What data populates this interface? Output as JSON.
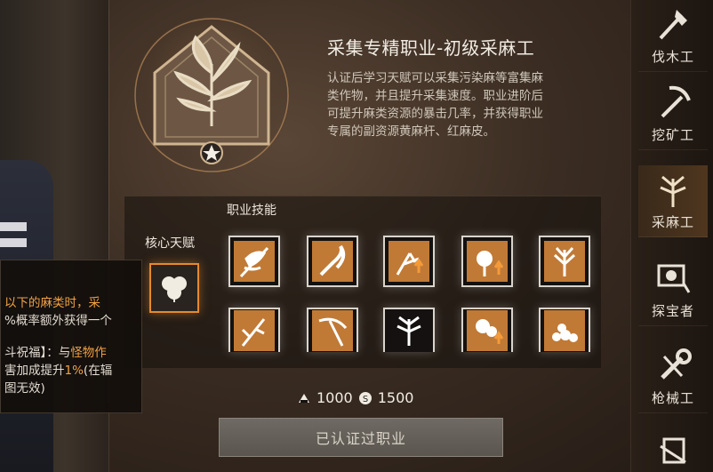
{
  "profession": {
    "title": "采集专精职业-初级采麻工",
    "description_lines": [
      "认证后学习天赋可以采集污染麻等富集麻",
      "类作物，并且提升采集速度。职业进阶后",
      "可提升麻类资源的暴击几率，并获得职业",
      "专属的副资源黄麻杆、红麻皮。"
    ]
  },
  "skills_section": {
    "label": "职业技能"
  },
  "core_talent": {
    "label": "核心天赋"
  },
  "tooltip": {
    "line1": "以下的麻类时，采",
    "line2": "%概率额外获得一个",
    "line3_a": "斗祝福】：与",
    "line3_b": "怪物作",
    "line4_a": "害加成提升",
    "line4_b": "1%",
    "line4_c": "(在辐",
    "line5": "图无效)"
  },
  "cost": {
    "resource_amount": "1000",
    "coin_amount": "1500"
  },
  "action_button": {
    "label": "已认证过职业"
  },
  "side_tabs": [
    {
      "label": "伐木工",
      "icon": "axe-icon",
      "active": false
    },
    {
      "label": "挖矿工",
      "icon": "pickaxe-icon",
      "active": false
    },
    {
      "label": "采麻工",
      "icon": "hemp-icon",
      "active": true
    },
    {
      "label": "探宝者",
      "icon": "metal-detector-icon",
      "active": false
    },
    {
      "label": "枪械工",
      "icon": "wrench-icon",
      "active": false
    },
    {
      "label": "",
      "icon": "armor-tool-icon",
      "active": false
    }
  ],
  "colors": {
    "accent": "#e58a2c",
    "highlight_text": "#f0a148"
  }
}
